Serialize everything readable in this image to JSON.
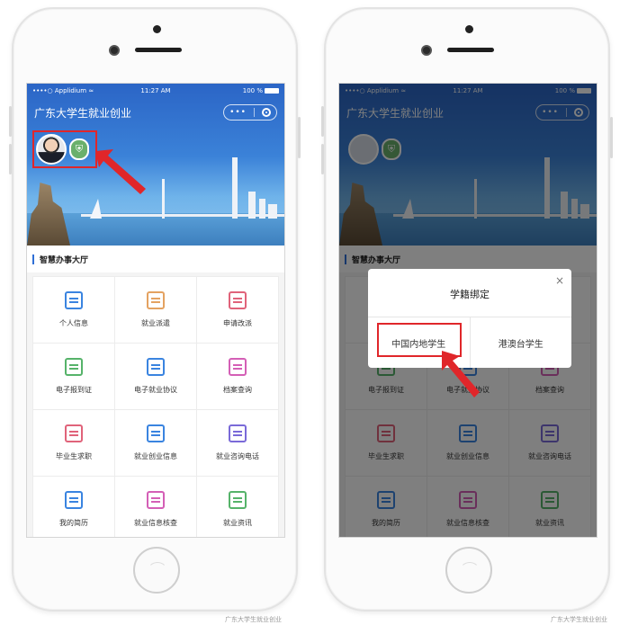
{
  "status_bar": {
    "carrier": "••••○ Applidium ≈",
    "time": "11:27 AM",
    "battery": "100 %"
  },
  "app": {
    "title": "广东大学生就业创业",
    "more_icon": "•••"
  },
  "section": {
    "title": "智慧办事大厅"
  },
  "grid_items": [
    {
      "label": "个人信息",
      "icon": "person-card-icon",
      "color": "#3a84e0"
    },
    {
      "label": "就业派遣",
      "icon": "document-list-icon",
      "color": "#e4a261"
    },
    {
      "label": "申请改派",
      "icon": "copy-docs-icon",
      "color": "#e0637a"
    },
    {
      "label": "电子报到证",
      "icon": "id-card-icon",
      "color": "#56b36a"
    },
    {
      "label": "电子就业协议",
      "icon": "agreement-doc-icon",
      "color": "#3a84e0"
    },
    {
      "label": "档案查询",
      "icon": "envelope-icon",
      "color": "#d45fb6"
    },
    {
      "label": "毕业生求职",
      "icon": "graduation-cap-icon",
      "color": "#e0637a"
    },
    {
      "label": "就业创业信息",
      "icon": "briefcase-icon",
      "color": "#3a84e0"
    },
    {
      "label": "就业咨询电话",
      "icon": "phone-icon",
      "color": "#7a6ad8"
    },
    {
      "label": "我的简历",
      "icon": "folder-icon",
      "color": "#3a84e0"
    },
    {
      "label": "就业信息核查",
      "icon": "badge-check-icon",
      "color": "#d45fb6"
    },
    {
      "label": "就业资讯",
      "icon": "news-list-icon",
      "color": "#56b36a"
    }
  ],
  "modal": {
    "title": "学籍绑定",
    "close": "×",
    "option_mainland": "中国内地学生",
    "option_hk_mo_tw": "港澳台学生"
  },
  "watermark": "广东大学生就业创业",
  "highlight_color": "#e0262a"
}
